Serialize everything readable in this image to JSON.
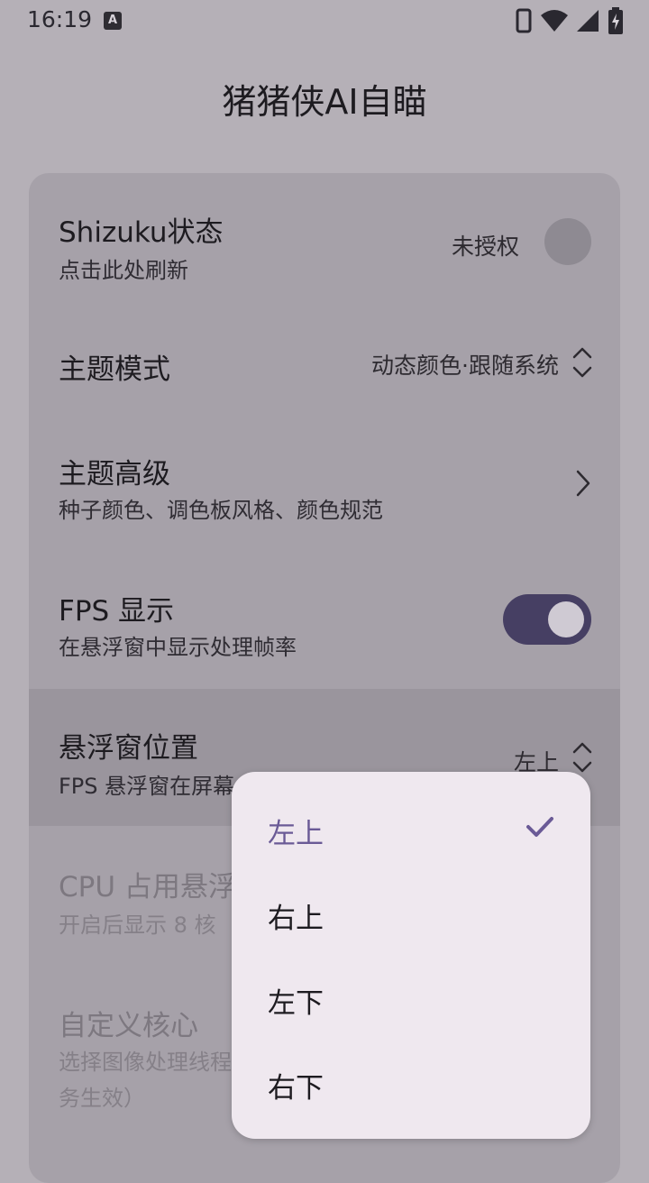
{
  "status_bar": {
    "time": "16:19",
    "notification_icon": "A"
  },
  "app": {
    "title": "猪猪侠AI自瞄"
  },
  "settings": {
    "shizuku": {
      "title": "Shizuku状态",
      "subtitle": "点击此处刷新",
      "value": "未授权"
    },
    "theme_mode": {
      "title": "主题模式",
      "value": "动态颜色·跟随系统"
    },
    "theme_advanced": {
      "title": "主题高级",
      "subtitle": "种子颜色、调色板风格、颜色规范"
    },
    "fps": {
      "title": "FPS 显示",
      "subtitle": "在悬浮窗中显示处理帧率",
      "enabled": true
    },
    "overlay_position": {
      "title": "悬浮窗位置",
      "subtitle": "FPS 悬浮窗在屏幕上的显示位置",
      "value": "左上"
    },
    "cpu": {
      "title": "CPU 占用悬浮窗",
      "subtitle": "开启后显示 8 核"
    },
    "custom_core": {
      "title": "自定义核心",
      "subtitle": "选择图像处理线程",
      "subtitle2": "务生效）"
    }
  },
  "dropdown": {
    "options": [
      "左上",
      "右上",
      "左下",
      "右下"
    ],
    "selected_index": 0
  },
  "colors": {
    "accent": "#6a5a96",
    "switch_track": "#463f63",
    "menu_bg": "#efe8ef",
    "scrim_bg": "#b5b0b7"
  }
}
